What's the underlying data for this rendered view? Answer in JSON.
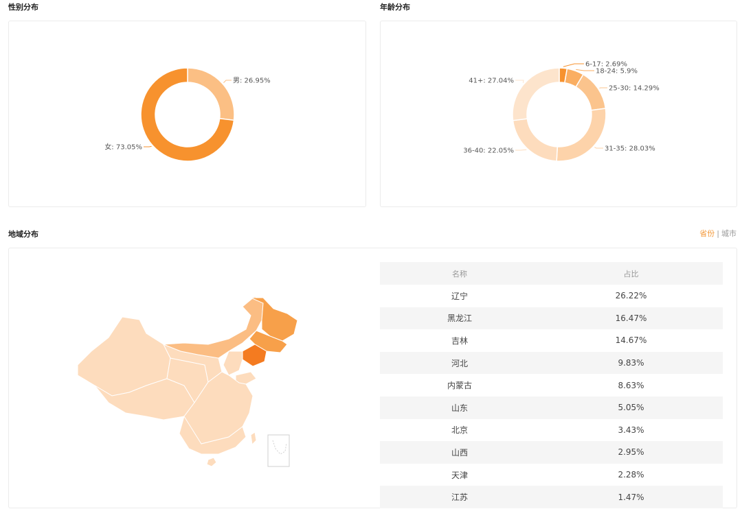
{
  "gender": {
    "title": "性别分布",
    "chart_data": {
      "type": "pie",
      "categories": [
        "男",
        "女"
      ],
      "values": [
        26.95,
        73.05
      ],
      "labels": [
        "男: 26.95%",
        "女: 73.05%"
      ],
      "colors": [
        "#fbbf84",
        "#f7922e"
      ]
    }
  },
  "age": {
    "title": "年龄分布",
    "chart_data": {
      "type": "pie",
      "categories": [
        "6-17",
        "18-24",
        "25-30",
        "31-35",
        "36-40",
        "41+"
      ],
      "values": [
        2.69,
        5.9,
        14.29,
        28.03,
        22.05,
        27.04
      ],
      "labels": [
        "6-17: 2.69%",
        "18-24: 5.9%",
        "25-30: 14.29%",
        "31-35: 28.03%",
        "36-40: 22.05%",
        "41+: 27.04%"
      ],
      "colors": [
        "#f7922e",
        "#faae62",
        "#fbc48d",
        "#fdd3aa",
        "#fddcbd",
        "#fde4cc"
      ]
    }
  },
  "region": {
    "title": "地域分布",
    "toggle": {
      "active": "省份",
      "separator": "|",
      "other": "城市"
    },
    "table": {
      "headers": [
        "名称",
        "占比"
      ],
      "rows": [
        [
          "辽宁",
          "26.22%"
        ],
        [
          "黑龙江",
          "16.47%"
        ],
        [
          "吉林",
          "14.67%"
        ],
        [
          "河北",
          "9.83%"
        ],
        [
          "内蒙古",
          "8.63%"
        ],
        [
          "山东",
          "5.05%"
        ],
        [
          "北京",
          "3.43%"
        ],
        [
          "山西",
          "2.95%"
        ],
        [
          "天津",
          "2.28%"
        ],
        [
          "江苏",
          "1.47%"
        ]
      ]
    },
    "map_colors": {
      "base": "#fddcbd",
      "mid": "#fbbd83",
      "high": "#f7a04a",
      "top": "#f47b20",
      "border": "#ffffff"
    }
  }
}
